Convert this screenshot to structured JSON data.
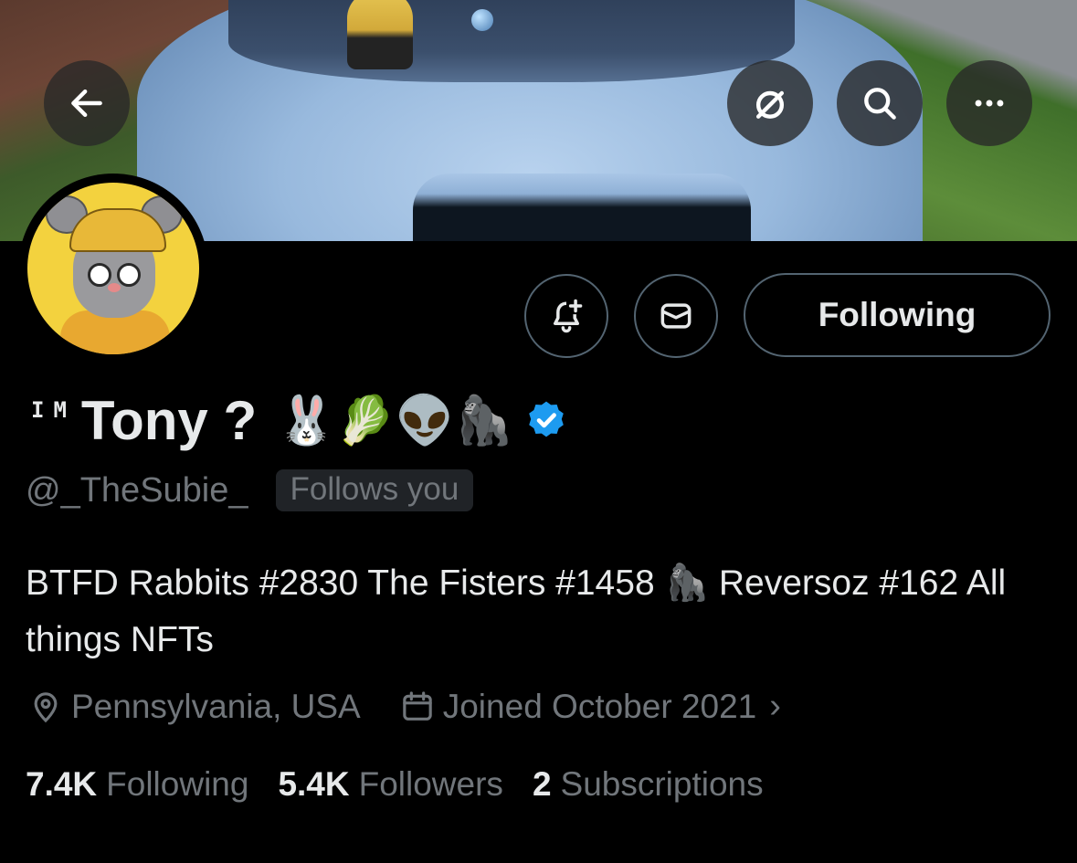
{
  "header": {
    "back_icon": "arrow-left-icon",
    "grok_icon": "slash-circle-icon",
    "search_icon": "search-icon",
    "more_icon": "more-dots-icon"
  },
  "profile": {
    "name_prefix": "IM",
    "display_name": "Tony ?",
    "name_emoji": "🐰🥬👽🦍",
    "verified": true,
    "handle": "@_TheSubie_",
    "follows_you": "Follows you",
    "bio": "BTFD Rabbits #2830 The Fisters #1458 🦍 Reversoz #162 All things NFTs",
    "location": "Pennsylvania, USA",
    "joined": "Joined October 2021"
  },
  "actions": {
    "notify_icon": "bell-plus-icon",
    "message_icon": "envelope-icon",
    "following_label": "Following"
  },
  "stats": [
    {
      "value": "7.4K",
      "label": "Following"
    },
    {
      "value": "5.4K",
      "label": "Followers"
    },
    {
      "value": "2",
      "label": "Subscriptions"
    }
  ],
  "colors": {
    "background": "#000000",
    "text_primary": "#e7e9ea",
    "text_secondary": "#71767b",
    "border": "#536471",
    "verified": "#1d9bf0"
  }
}
